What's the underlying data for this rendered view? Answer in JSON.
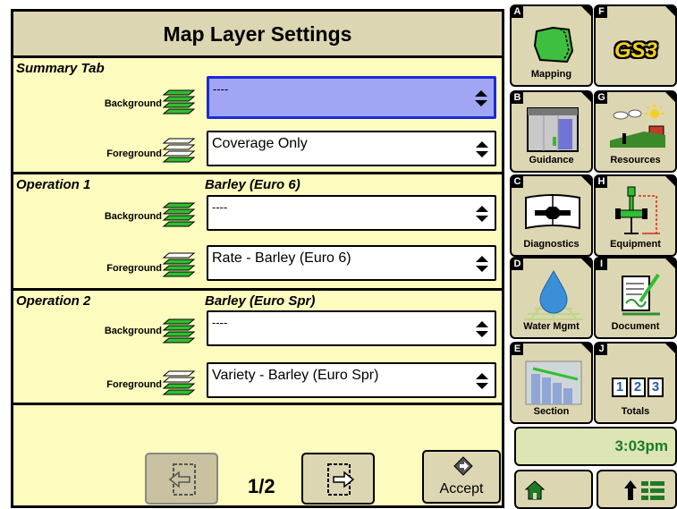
{
  "title": "Map Layer Settings",
  "sections": [
    {
      "title": "Summary Tab",
      "crop": "",
      "rows": [
        {
          "label": "Background",
          "value": "----",
          "selected": true
        },
        {
          "label": "Foreground",
          "value": "Coverage Only",
          "selected": false
        }
      ]
    },
    {
      "title": "Operation 1",
      "crop": "Barley (Euro 6)",
      "rows": [
        {
          "label": "Background",
          "value": "----",
          "selected": false
        },
        {
          "label": "Foreground",
          "value": "Rate - Barley (Euro 6)",
          "selected": false
        }
      ]
    },
    {
      "title": "Operation 2",
      "crop": "Barley (Euro Spr)",
      "rows": [
        {
          "label": "Background",
          "value": "----",
          "selected": false
        },
        {
          "label": "Foreground",
          "value": "Variety - Barley (Euro Spr)",
          "selected": false
        }
      ]
    }
  ],
  "nav": {
    "page": "1/2",
    "accept_label": "Accept"
  },
  "apps": [
    {
      "letter": "A",
      "label": "Mapping",
      "icon": "field-map-icon"
    },
    {
      "letter": "F",
      "label": "",
      "icon": "gs3-logo"
    },
    {
      "letter": "B",
      "label": "Guidance",
      "icon": "guidance-icon"
    },
    {
      "letter": "G",
      "label": "Resources",
      "icon": "resources-icon"
    },
    {
      "letter": "C",
      "label": "Diagnostics",
      "icon": "wrench-book-icon"
    },
    {
      "letter": "H",
      "label": "Equipment",
      "icon": "equipment-icon"
    },
    {
      "letter": "D",
      "label": "Water Mgmt",
      "icon": "water-drop-icon"
    },
    {
      "letter": "I",
      "label": "Document",
      "icon": "document-pen-icon"
    },
    {
      "letter": "E",
      "label": "Section",
      "icon": "section-control-icon"
    },
    {
      "letter": "J",
      "label": "Totals",
      "icon": "totals-counter-icon"
    }
  ],
  "gs3_text": "GS3",
  "totals_digits": [
    "1",
    "2",
    "3"
  ],
  "clock": "3:03pm",
  "colors": {
    "panel_bg": "#fdfbbe",
    "header_bg": "#ddd6b2",
    "selected_dropdown": "#a0a6f4",
    "selected_border": "#1a2bd9",
    "layer_green": "#2fbf2f",
    "clock_green": "#1a7d24"
  }
}
